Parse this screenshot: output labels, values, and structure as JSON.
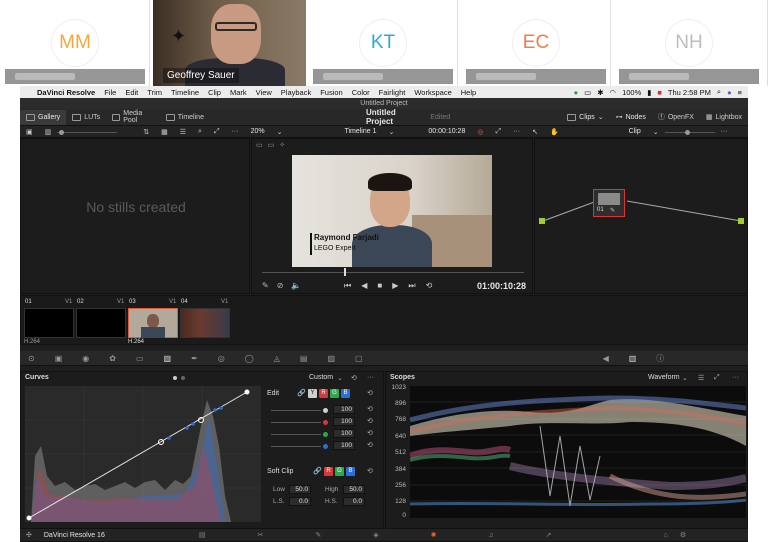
{
  "call": {
    "tiles": [
      {
        "initials": "MM",
        "color": "#f0a93a"
      },
      {
        "initials": "KT",
        "color": "#2fa8d8"
      },
      {
        "initials": "EC",
        "color": "#e8804a"
      },
      {
        "initials": "NH",
        "color": "#bdbdbd"
      }
    ],
    "speaker_name": "Geoffrey Sauer"
  },
  "menubar": {
    "app": "DaVinci Resolve",
    "items": [
      "File",
      "Edit",
      "Trim",
      "Timeline",
      "Clip",
      "Mark",
      "View",
      "Playback",
      "Fusion",
      "Color",
      "Fairlight",
      "Workspace",
      "Help"
    ],
    "battery": "100%",
    "clock": "Thu 2:58 PM"
  },
  "window_title": "Untitled Project",
  "toolbar": {
    "gallery": "Gallery",
    "luts": "LUTs",
    "media_pool": "Media Pool",
    "timeline": "Timeline",
    "project": "Untitled Project",
    "edited": "Edited",
    "clips": "Clips",
    "nodes": "Nodes",
    "openfx": "OpenFX",
    "lightbox": "Lightbox"
  },
  "viewer": {
    "zoom": "20%",
    "timeline_name": "Timeline 1",
    "timecode_top": "00:00:10:28",
    "timecode": "01:00:10:28",
    "lower_third_name": "Raymond Farjadi",
    "lower_third_title": "LEGO Expert",
    "clip_mode": "Clip"
  },
  "gallery": {
    "empty": "No stills created"
  },
  "timeline_clips": [
    {
      "num": "01",
      "track": "V1",
      "codec": "H.264"
    },
    {
      "num": "02",
      "track": "V1",
      "codec": ""
    },
    {
      "num": "03",
      "track": "V1",
      "codec": "H.264"
    },
    {
      "num": "04",
      "track": "V1",
      "codec": ""
    }
  ],
  "node": {
    "label": "01"
  },
  "curves": {
    "title": "Curves",
    "mode": "Custom",
    "edit_label": "Edit",
    "channels": [
      "Y",
      "R",
      "G",
      "B"
    ],
    "channel_colors": [
      "#cfcfcf",
      "#d43a3a",
      "#2ea84a",
      "#2d6fd6"
    ],
    "values": [
      "100",
      "100",
      "100",
      "100"
    ],
    "soft_clip_label": "Soft Clip",
    "low_label": "Low",
    "low_value": "50.0",
    "high_label": "High",
    "high_value": "50.0",
    "ls_label": "L.S.",
    "ls_value": "0.0",
    "hs_label": "H.S.",
    "hs_value": "0.0"
  },
  "scopes": {
    "title": "Scopes",
    "mode": "Waveform",
    "levels": [
      "1023",
      "896",
      "768",
      "640",
      "512",
      "384",
      "256",
      "128",
      "0"
    ]
  },
  "footer": {
    "app_version": "DaVinci Resolve 16"
  }
}
